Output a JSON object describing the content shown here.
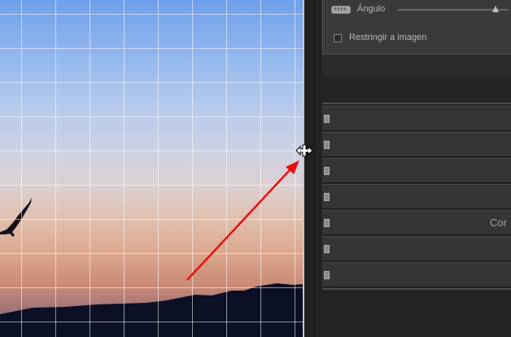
{
  "panel": {
    "angle_label": "Ángulo",
    "angle_slider_value": 0.85,
    "constrain_label": "Restringir a imagen",
    "constrain_checked": false,
    "partial_label": "Cor"
  },
  "colors": {
    "annotation_arrow": "#e81010",
    "grid_lines": "#ffffff",
    "panel_bg": "#2b2b2b"
  },
  "icons": [
    "straighten-tool-icon",
    "resize-horizontal-cursor-icon",
    "gaviota-silhouette"
  ]
}
